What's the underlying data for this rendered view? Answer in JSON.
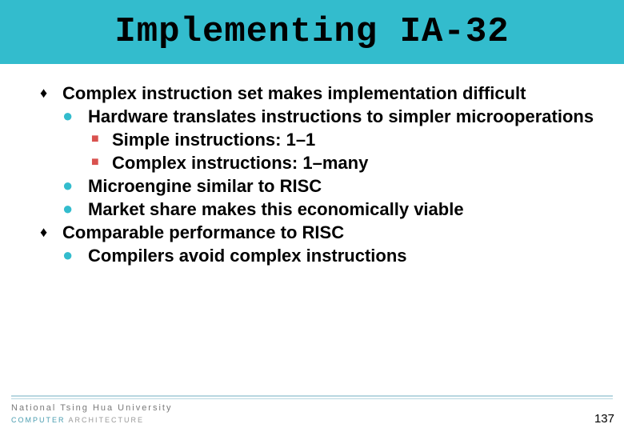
{
  "title": "Implementing IA-32",
  "bullets": [
    {
      "text": "Complex instruction set makes implementation difficult",
      "children": [
        {
          "text": "Hardware translates instructions to simpler microoperations",
          "children": [
            {
              "text": "Simple instructions: 1–1"
            },
            {
              "text": "Complex instructions: 1–many"
            }
          ]
        },
        {
          "text": "Microengine similar to RISC"
        },
        {
          "text": "Market share makes this economically viable"
        }
      ]
    },
    {
      "text": "Comparable performance to RISC",
      "children": [
        {
          "text": "Compilers avoid complex instructions"
        }
      ]
    }
  ],
  "footer": {
    "university": "National Tsing Hua University",
    "dept_c": "COMPUTER",
    "dept_a": " ARCHITECTURE"
  },
  "page_number": "137"
}
